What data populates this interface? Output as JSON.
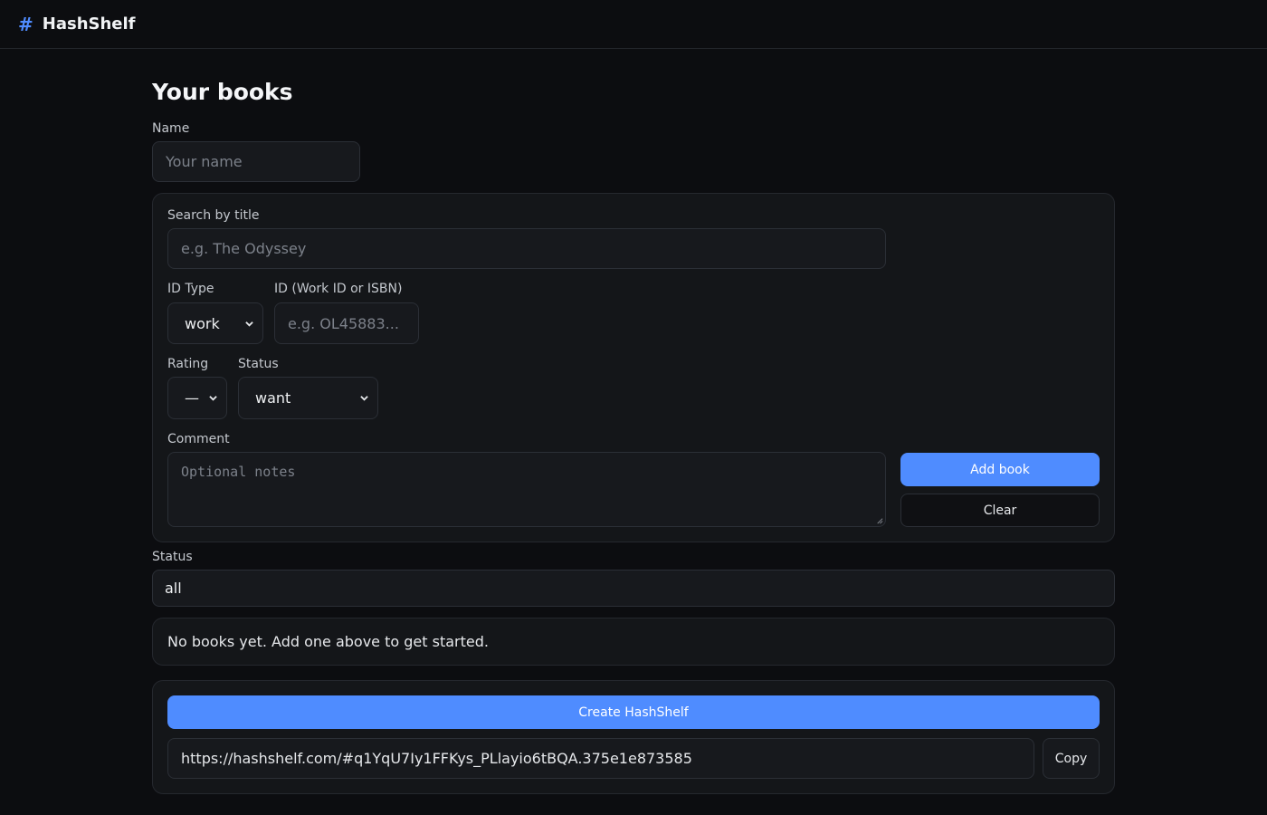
{
  "app": {
    "logo_symbol": "#",
    "title": "HashShelf"
  },
  "page": {
    "heading": "Your books"
  },
  "name_field": {
    "label": "Name",
    "placeholder": "Your name"
  },
  "add_form": {
    "search_label": "Search by title",
    "search_placeholder": "e.g. The Odyssey",
    "id_type_label": "ID Type",
    "id_type_value": "work",
    "id_label": "ID (Work ID or ISBN)",
    "id_placeholder": "e.g. OL45883...",
    "rating_label": "Rating",
    "rating_value": "—",
    "status_label": "Status",
    "status_value": "want",
    "comment_label": "Comment",
    "comment_placeholder": "Optional notes",
    "add_button": "Add book",
    "clear_button": "Clear"
  },
  "filter": {
    "label": "Status",
    "value": "all"
  },
  "empty_state": {
    "message": "No books yet. Add one above to get started."
  },
  "share": {
    "create_button": "Create HashShelf",
    "url": "https://hashshelf.com/#q1YqU7Iy1FFKys_PLlayio6tBQA.375e1e873585",
    "copy_button": "Copy"
  },
  "colors": {
    "accent": "#4f8cff",
    "background": "#0c0d10",
    "card": "#141619"
  },
  "icons": {
    "select_arrow": "chevron-down-icon"
  }
}
